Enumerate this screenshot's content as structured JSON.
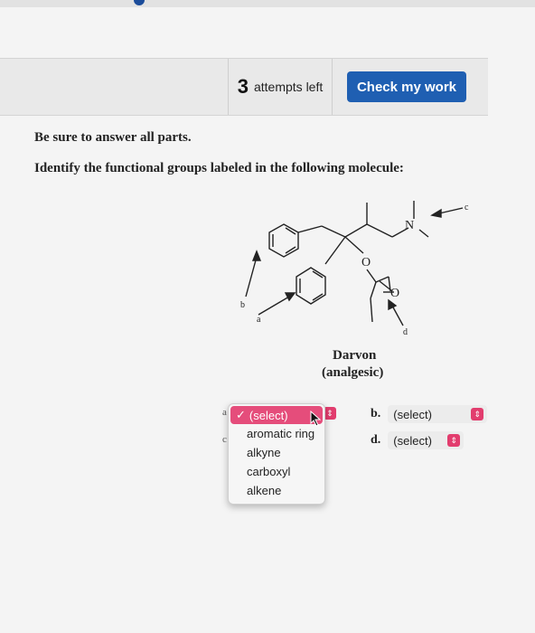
{
  "toolbar": {
    "attempts_count": "3",
    "attempts_label": "attempts left",
    "check_button": "Check my work"
  },
  "instructions": {
    "line1": "Be sure to answer all parts.",
    "line2": "Identify the functional groups labeled in the following molecule:"
  },
  "molecule": {
    "atom_N": "N",
    "atom_O1": "O",
    "atom_O2": "O",
    "label_a": "a",
    "label_b": "b",
    "label_c": "c",
    "label_d": "d",
    "name": "Darvon",
    "class": "(analgesic)"
  },
  "selects": {
    "a": {
      "letter": "a",
      "value": "(select)"
    },
    "b": {
      "letter": "b.",
      "value": "(select)"
    },
    "c": {
      "letter": "c",
      "value": "(select)"
    },
    "d": {
      "letter": "d.",
      "value": "(select)"
    }
  },
  "dropdown": {
    "selected": "(select)",
    "checkmark": "✓",
    "options": [
      "aromatic ring",
      "alkyne",
      "carboxyl",
      "alkene"
    ]
  },
  "colors": {
    "check_button": "#1f5fb2",
    "select_accent": "#e23d6e",
    "dropdown_highlight": "#e54d7b"
  }
}
